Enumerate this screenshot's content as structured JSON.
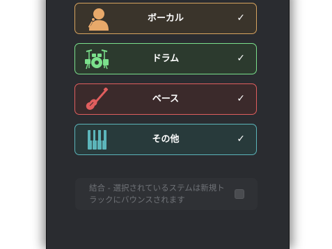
{
  "stems": [
    {
      "id": "vocals",
      "label": "ボーカル",
      "checked": true,
      "icon": "singer-icon",
      "color": "#d7a45f"
    },
    {
      "id": "drums",
      "label": "ドラム",
      "checked": true,
      "icon": "drum-kit-icon",
      "color": "#7be08c"
    },
    {
      "id": "bass",
      "label": "ベース",
      "checked": true,
      "icon": "bass-guitar-icon",
      "color": "#e05e5e"
    },
    {
      "id": "other",
      "label": "その他",
      "checked": true,
      "icon": "piano-keys-icon",
      "color": "#5cb5ba"
    }
  ],
  "check_mark": "✓",
  "merge_option": {
    "text": "結合 - 選択されているステムは新規トラックにバウンスされます",
    "checked": false,
    "enabled": false
  }
}
